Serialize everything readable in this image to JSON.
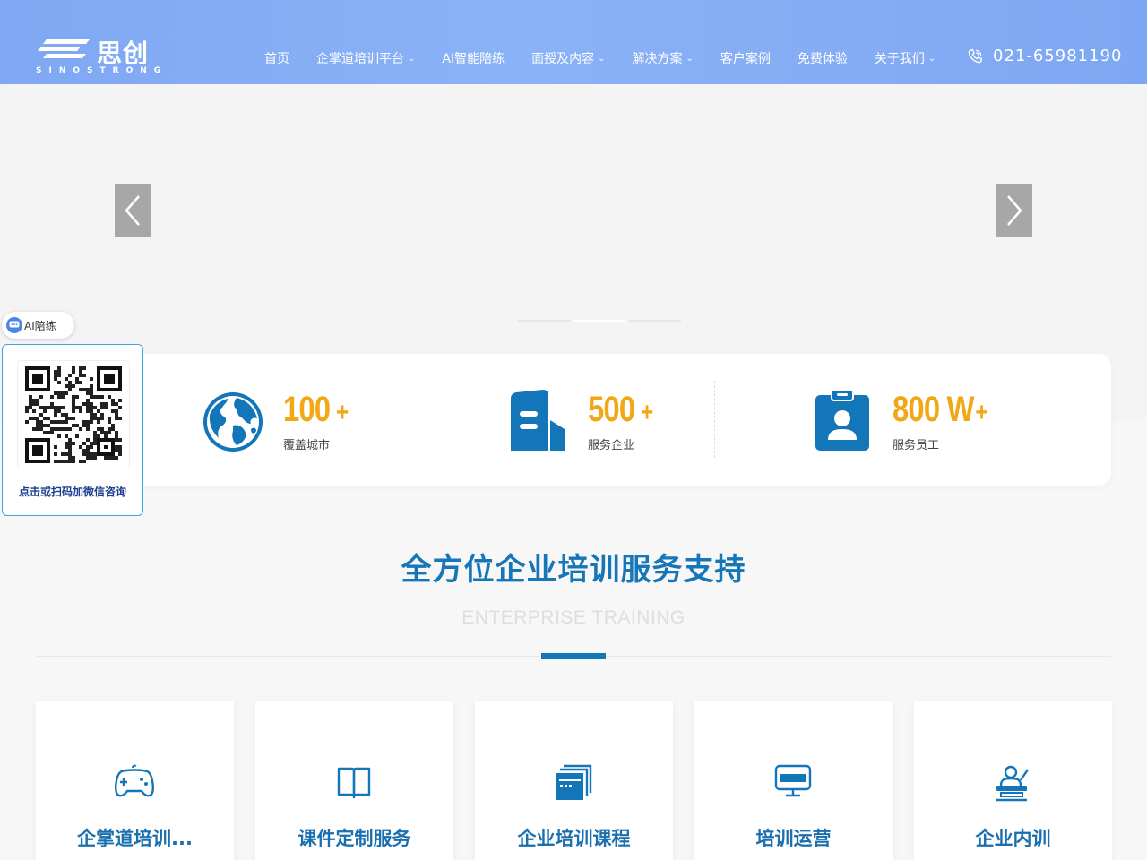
{
  "header": {
    "logo_cn": "思创",
    "logo_en": "SINOSTRONG",
    "nav": [
      {
        "label": "首页",
        "has_caret": false
      },
      {
        "label": "企掌道培训平台",
        "has_caret": true
      },
      {
        "label": "AI智能陪练",
        "has_caret": false
      },
      {
        "label": "面授及内容",
        "has_caret": true
      },
      {
        "label": "解决方案",
        "has_caret": true
      },
      {
        "label": "客户案例",
        "has_caret": false
      },
      {
        "label": "免费体验",
        "has_caret": false
      },
      {
        "label": "关于我们",
        "has_caret": true
      }
    ],
    "caret": "⌄",
    "phone": "021-65981190",
    "phone_icon": "phone-icon"
  },
  "banner": {
    "slides_count": 3,
    "active_slide": 2
  },
  "stats": [
    {
      "number": "100",
      "suffix": "+",
      "label": "覆盖城市",
      "icon": "globe-icon"
    },
    {
      "number": "500",
      "suffix": "+",
      "label": "服务企业",
      "icon": "building-icon"
    },
    {
      "number": "800 W",
      "suffix": "+",
      "label": "服务员工",
      "icon": "employee-badge-icon"
    }
  ],
  "widgets": {
    "ai_pill": "AI陪练",
    "qr_caption": "点击或扫码加微信咨询"
  },
  "section": {
    "title": "全方位企业培训服务支持",
    "subtitle": "ENTERPRISE  TRAINING",
    "cards": [
      {
        "label": "企掌道培训...",
        "icon": "gamepad-icon"
      },
      {
        "label": "课件定制服务",
        "icon": "book-icon"
      },
      {
        "label": "企业培训课程",
        "icon": "window-stack-icon"
      },
      {
        "label": "培训运营",
        "icon": "monitor-icon"
      },
      {
        "label": "企业内训",
        "icon": "lecturer-icon"
      }
    ]
  },
  "colors": {
    "header_gradient": "#7fa8f4",
    "accent_blue": "#1676b8",
    "number_orange": "#f2a816",
    "icon_blue": "#1376b9"
  }
}
